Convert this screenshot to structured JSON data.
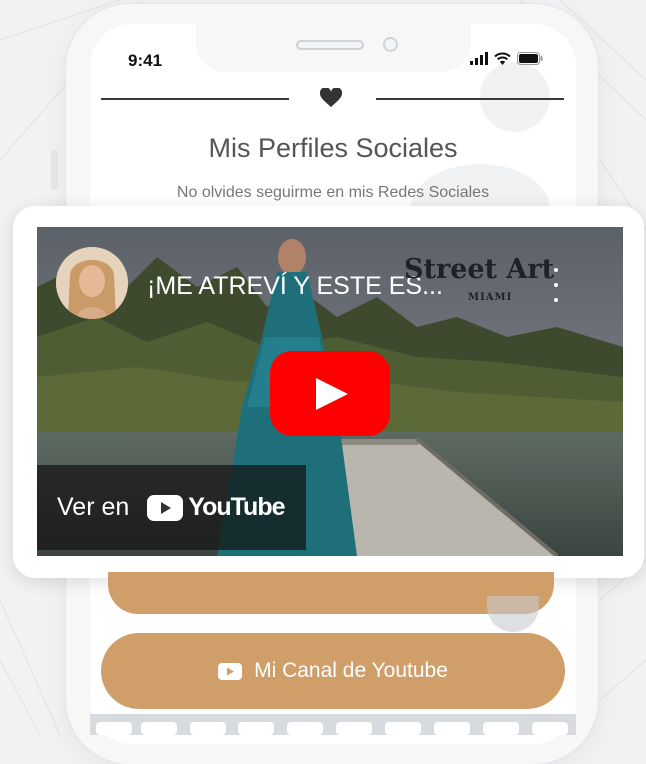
{
  "status_bar": {
    "time": "9:41"
  },
  "header": {
    "heart_icon": "heart-icon",
    "title": "Mis Perfiles Sociales",
    "subtitle": "No olvides seguirme en mis Redes Sociales"
  },
  "video": {
    "title": "¡ME ATREVÍ Y ESTE ES...",
    "watermark": "Street Art",
    "watermark_sub": "MIAMI",
    "watch_on_label": "Ver en",
    "youtube_wordmark": "YouTube",
    "play_icon": "play-icon",
    "menu_icon": "more-vertical-icon"
  },
  "buttons": {
    "youtube_channel": "Mi Canal de Youtube"
  },
  "colors": {
    "accent_tan": "#d09e68",
    "youtube_red": "#fe0000"
  }
}
